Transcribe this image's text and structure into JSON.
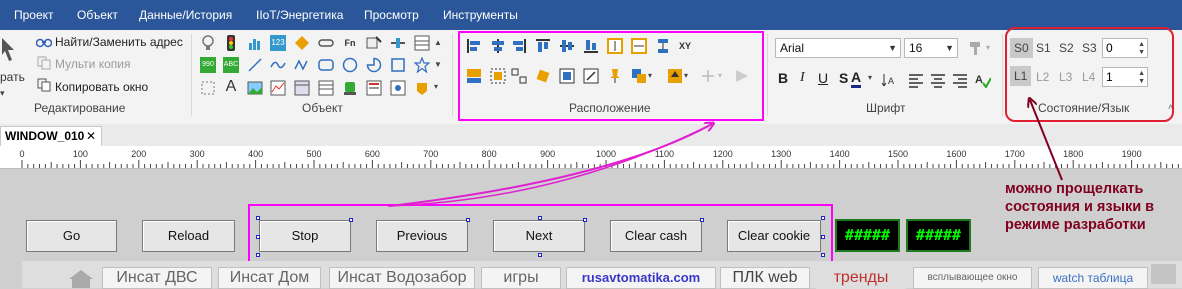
{
  "menu": [
    "Проект",
    "Объект",
    "Данные/История",
    "IIoT/Энергетика",
    "Просмотр",
    "Инструменты"
  ],
  "ribbon": {
    "editing": {
      "find_replace": "Найти/Заменить адрес",
      "multi_copy": "Мульти копия",
      "copy_window": "Копировать окно",
      "partial_label": "рать",
      "group_label": "Редактирование"
    },
    "object_group": {
      "label": "Объект",
      "icon_labels": [
        "123",
        "Fn",
        "990",
        "ABC"
      ]
    },
    "layout_group": {
      "label": "Расположение",
      "xy_icon_label": "XY"
    },
    "font_group": {
      "label": "Шрифт",
      "font_name": "Arial",
      "font_size": "16"
    },
    "state_group": {
      "label": "Состояние/Язык",
      "states": [
        "S0",
        "S1",
        "S2",
        "S3"
      ],
      "languages": [
        "L1",
        "L2",
        "L3",
        "L4"
      ],
      "state_value": "0",
      "language_value": "1"
    }
  },
  "document_tab": {
    "title": "WINDOW_010",
    "close": "✕"
  },
  "ruler": {
    "labels": [
      "0",
      "100",
      "200",
      "300",
      "400",
      "500",
      "600",
      "700",
      "800",
      "900",
      "1000",
      "1100",
      "1200",
      "1300",
      "1400",
      "1500",
      "1600",
      "1700",
      "1800",
      "1900"
    ]
  },
  "buttons": [
    "Go",
    "Reload",
    "Stop",
    "Previous",
    "Next",
    "Clear cash",
    "Clear cookie"
  ],
  "displays": [
    "#####",
    "#####"
  ],
  "nav_tabs": [
    "Инсат ДВС",
    "Инсат Дом",
    "Инсат Водозабор",
    "игры",
    "rusavtomatika.com",
    "ПЛК web",
    "тренды",
    "всплывающее окно",
    "watch таблица"
  ],
  "annotation": "можно прощелкать состояния и языки в режиме разработки",
  "colors": {
    "menubar": "#2b579a",
    "highlight_magenta": "#ff00ff",
    "highlight_red": "#e02030",
    "annotation_text": "#800020",
    "display_green": "#00ff00",
    "rusavtomatika_blue": "#3a37c8",
    "trend_red": "#c03030",
    "watch_blue": "#3b6fc4"
  }
}
